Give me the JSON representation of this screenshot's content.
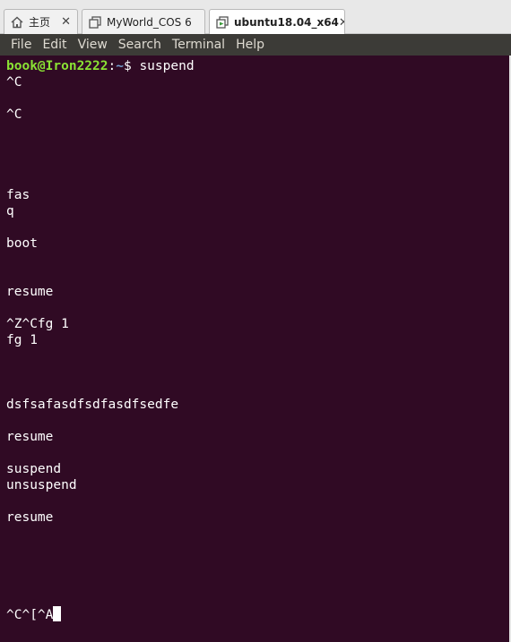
{
  "tabs": [
    {
      "label": "主页",
      "icon": "home-icon",
      "closable": true
    },
    {
      "label": "MyWorld_COS 6",
      "icon": "vm-icon",
      "closable": false
    },
    {
      "label": "ubuntu18.04_x64",
      "icon": "vm-running-icon",
      "closable": true,
      "active": true
    }
  ],
  "close_glyph": "✕",
  "menu": [
    "File",
    "Edit",
    "View",
    "Search",
    "Terminal",
    "Help"
  ],
  "terminal": {
    "prompt_user": "book@Iron2222",
    "prompt_sep": ":",
    "prompt_path": "~",
    "prompt_end": "$ ",
    "command": "suspend",
    "lines": [
      "^C",
      "",
      "^C",
      "",
      "",
      "",
      "",
      "fas",
      "q",
      "",
      "boot",
      "",
      "",
      "resume",
      "",
      "^Z^Cfg 1",
      "fg 1",
      "",
      "",
      "",
      "dsfsafasdfsdfasdfsedfe",
      "",
      "resume",
      "",
      "suspend",
      "unsuspend",
      "",
      "resume",
      "",
      "",
      "",
      "",
      ""
    ],
    "last_line": "^C^[^A"
  }
}
